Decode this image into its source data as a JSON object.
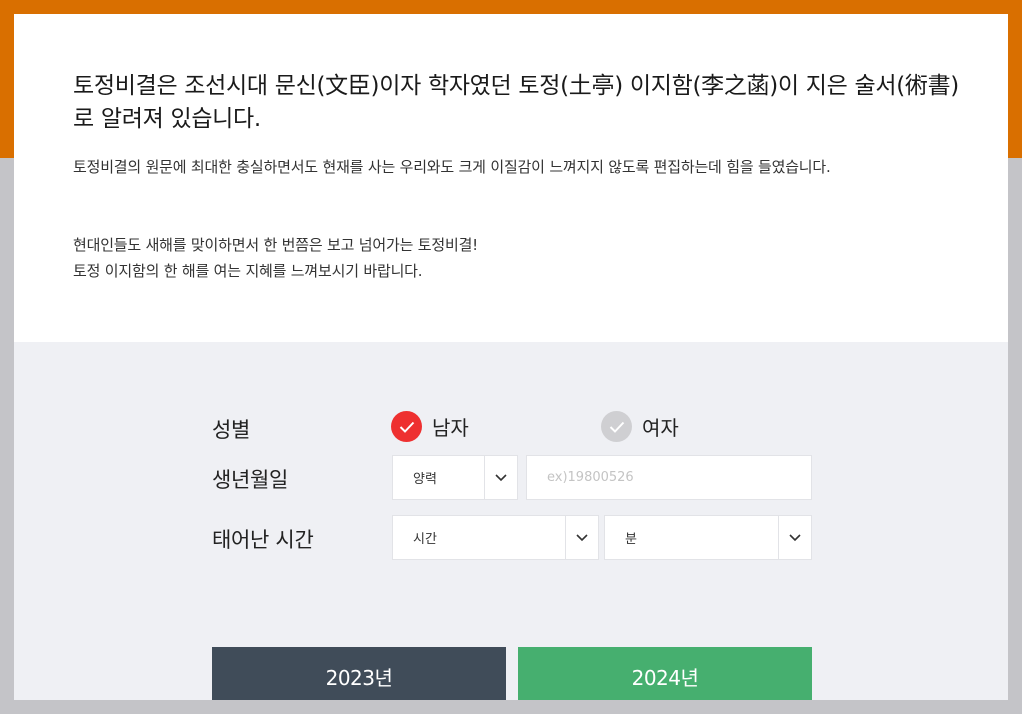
{
  "intro": {
    "headline": "토정비결은 조선시대 문신(文臣)이자 학자였던 토정(土亭) 이지함(李之菡)이 지은 술서(術書)로 알려져 있습니다.",
    "paragraph1": "토정비결의 원문에 최대한 충실하면서도 현재를 사는 우리와도 크게 이질감이 느껴지지 않도록 편집하는데 힘을 들였습니다.",
    "paragraph2_line1": "현대인들도 새해를 맞이하면서 한 번쯤은 보고 넘어가는 토정비결!",
    "paragraph2_line2": "토정 이지함의 한 해를 여는 지혜를 느껴보시기 바랍니다."
  },
  "form": {
    "gender_label": "성별",
    "gender_options": [
      "남자",
      "여자"
    ],
    "gender_selected": "남자",
    "birth_label": "생년월일",
    "calendar_select": "양력",
    "birth_placeholder": "ex)19800526",
    "birth_value": "",
    "time_label": "태어난 시간",
    "hour_select": "시간",
    "minute_select": "분"
  },
  "buttons": {
    "year_2023": "2023년",
    "year_2024": "2024년"
  },
  "colors": {
    "accent_orange": "#d96f00",
    "radio_on": "#ee3030",
    "button_dark": "#404c59",
    "button_green": "#46af6f"
  }
}
